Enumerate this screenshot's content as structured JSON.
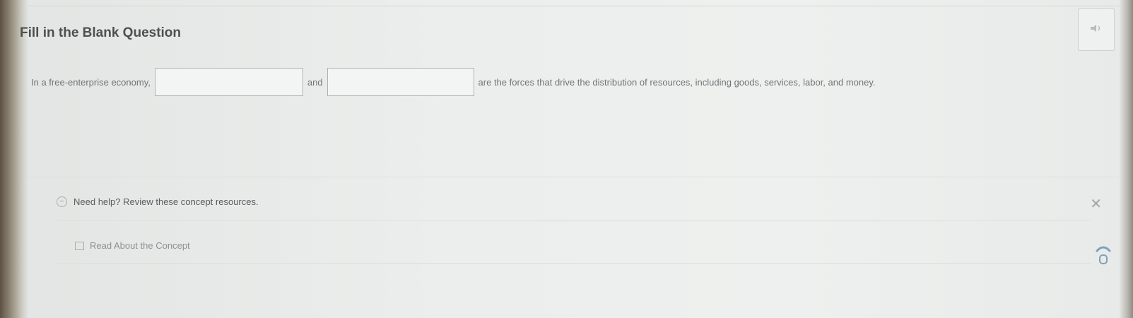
{
  "question": {
    "title": "Fill in the Blank Question",
    "sentence_part1": "In a free-enterprise economy,",
    "blank1_value": "",
    "connector": "and",
    "blank2_value": "",
    "sentence_part2": "are the forces that drive the distribution of resources, including goods, services, labor, and money."
  },
  "help": {
    "label": "Need help? Review these concept resources.",
    "resource_link": "Read About the Concept"
  },
  "icons": {
    "audio": "speaker-icon",
    "collapse": "minus-circle-icon",
    "close": "close-icon",
    "resource": "book-icon",
    "scroll": "scroll-hint-icon"
  },
  "colors": {
    "background": "#eceeed",
    "title": "#4c5051",
    "body_text": "#6f7475",
    "blank_border": "#aeb4b2"
  }
}
